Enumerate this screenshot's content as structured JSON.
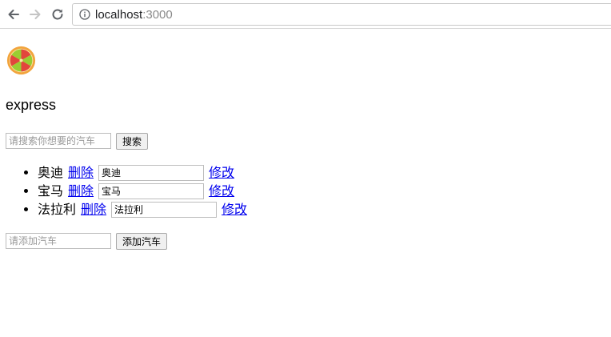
{
  "browser": {
    "url_host": "localhost",
    "url_port": ":3000"
  },
  "page": {
    "heading": "express",
    "search": {
      "placeholder": "请搜索你想要的汽车",
      "button_label": "搜索"
    },
    "cars": [
      {
        "name": "奥迪",
        "delete_label": "删除",
        "edit_value": "奥迪",
        "modify_label": "修改"
      },
      {
        "name": "宝马",
        "delete_label": "删除",
        "edit_value": "宝马",
        "modify_label": "修改"
      },
      {
        "name": "法拉利",
        "delete_label": "删除",
        "edit_value": "法拉利",
        "modify_label": "修改"
      }
    ],
    "add": {
      "placeholder": "请添加汽车",
      "button_label": "添加汽车"
    }
  },
  "colors": {
    "link": "#0000ee",
    "logo_rind": "#f2a43c",
    "logo_red": "#e2463c",
    "logo_green": "#9acd32"
  }
}
